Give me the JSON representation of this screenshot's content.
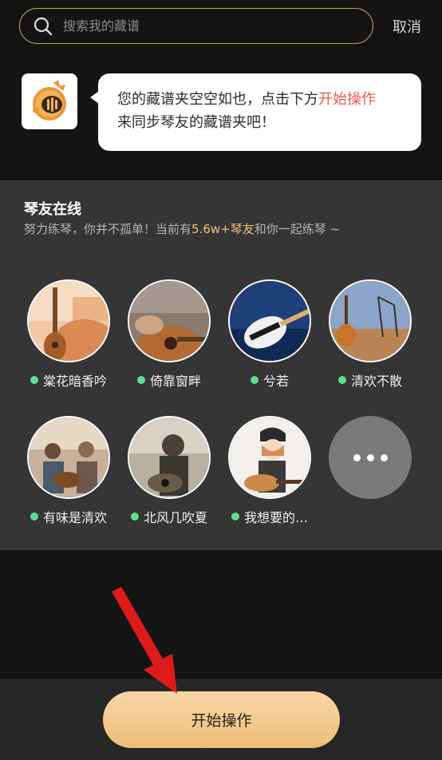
{
  "search": {
    "placeholder": "搜索我的藏谱",
    "cancel_label": "取消"
  },
  "message": {
    "line1_prefix": "您的藏谱夹空空如也，点击下方",
    "line1_highlight": "开始操作",
    "line2": "来同步琴友的藏谱夹吧！"
  },
  "online": {
    "title": "琴友在线",
    "sub_prefix": "努力练琴，你并不孤单！当前有",
    "sub_count": "5.6w+琴友",
    "sub_suffix": "和你一起练琴 ~",
    "friends": [
      {
        "name": "棠花暗香吟"
      },
      {
        "name": "倚靠窗畔"
      },
      {
        "name": "兮若"
      },
      {
        "name": "清欢不散"
      },
      {
        "name": "有味是清欢"
      },
      {
        "name": "北风几吹夏"
      },
      {
        "name": "我想要的…"
      }
    ]
  },
  "bottom": {
    "start_label": "开始操作"
  },
  "colors": {
    "accent_gold": "#c9a06a",
    "highlight_red": "#e65b4d",
    "online_dot": "#5ee08a"
  }
}
